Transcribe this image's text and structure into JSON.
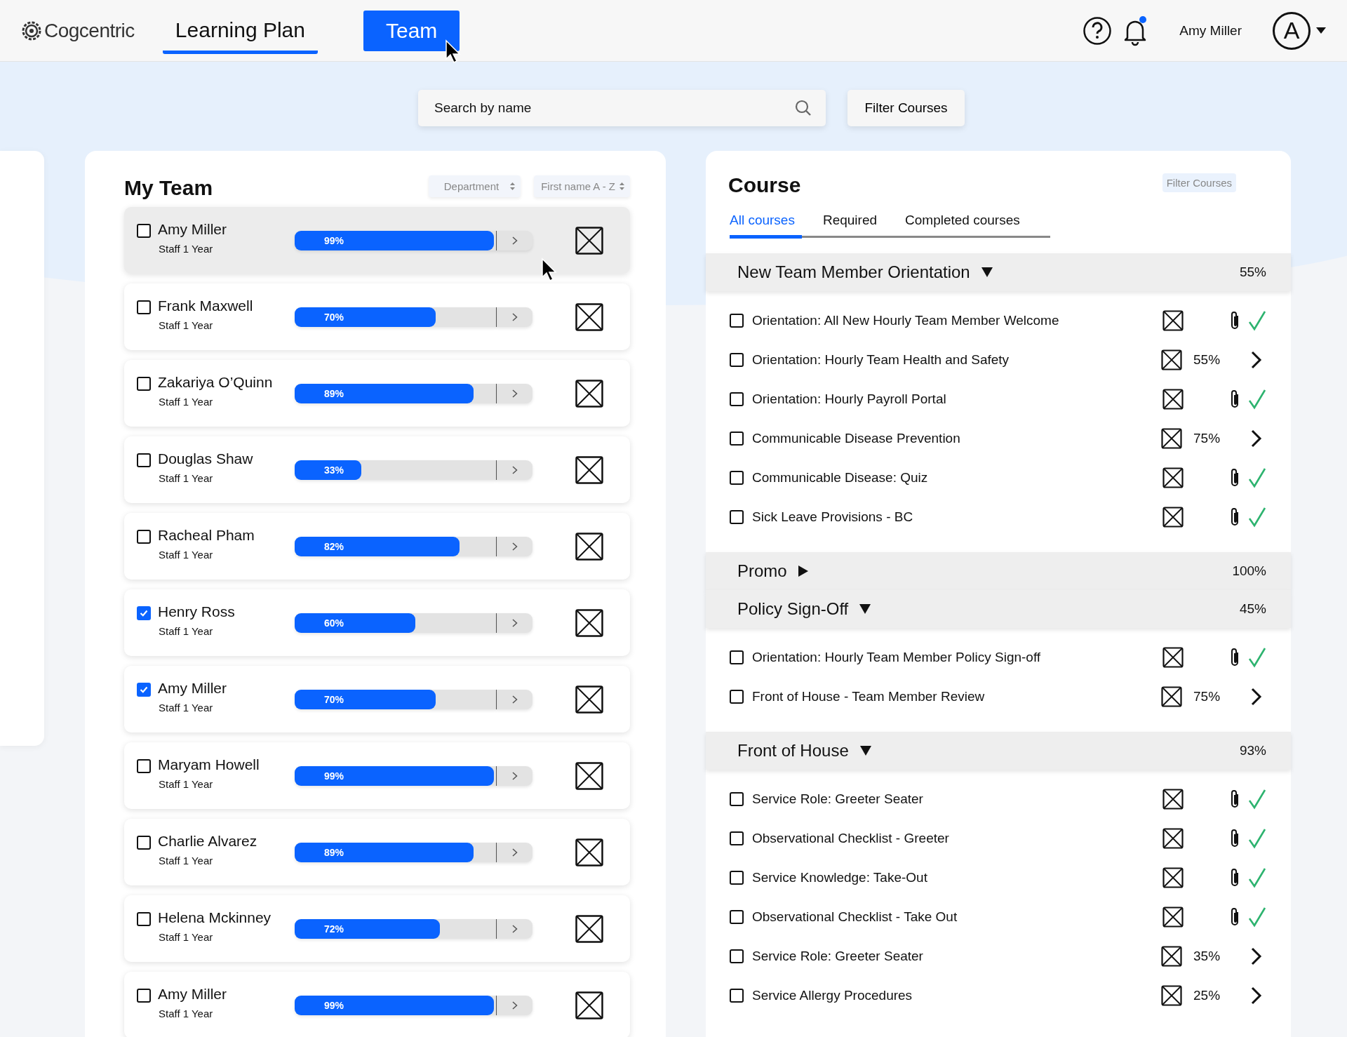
{
  "header": {
    "logo": "Cogcentric",
    "nav": [
      {
        "label": "Learning Plan",
        "selected": true,
        "kind": "tab"
      },
      {
        "label": "Team",
        "selected": false,
        "kind": "button"
      }
    ],
    "notifications": {
      "unread": true
    },
    "user": {
      "name": "Amy Miller",
      "avatar": "A"
    }
  },
  "search": {
    "placeholder": "Search by name"
  },
  "filter_button": "Filter Courses",
  "team": {
    "title": "My Team",
    "sorts": [
      "Department",
      "First name A - Z"
    ],
    "members": [
      {
        "name": "Amy Miller",
        "role": "Staff 1 Year",
        "level": 0.99,
        "reading": "99%",
        "checked": false,
        "highlighted": true
      },
      {
        "name": "Frank Maxwell",
        "role": "Staff 1 Year",
        "level": 0.7,
        "reading": "70%",
        "checked": false,
        "highlighted": false
      },
      {
        "name": "Zakariya O’Quinn",
        "role": "Staff 1 Year",
        "level": 0.89,
        "reading": "89%",
        "checked": false,
        "highlighted": false
      },
      {
        "name": "Douglas Shaw",
        "role": "Staff 1 Year",
        "level": 0.33,
        "reading": "33%",
        "checked": false,
        "highlighted": false
      },
      {
        "name": "Racheal Pham",
        "role": "Staff 1 Year",
        "level": 0.82,
        "reading": "82%",
        "checked": false,
        "highlighted": false
      },
      {
        "name": "Henry Ross",
        "role": "Staff 1 Year",
        "level": 0.6,
        "reading": "60%",
        "checked": true,
        "highlighted": false
      },
      {
        "name": "Amy Miller",
        "role": "Staff 1 Year",
        "level": 0.7,
        "reading": "70%",
        "checked": true,
        "highlighted": false
      },
      {
        "name": "Maryam Howell",
        "role": "Staff 1 Year",
        "level": 0.99,
        "reading": "99%",
        "checked": false,
        "highlighted": false
      },
      {
        "name": "Charlie Alvarez",
        "role": "Staff 1 Year",
        "level": 0.89,
        "reading": "89%",
        "checked": false,
        "highlighted": false
      },
      {
        "name": "Helena Mckinney",
        "role": "Staff 1 Year",
        "level": 0.72,
        "reading": "72%",
        "checked": false,
        "highlighted": false
      },
      {
        "name": "Amy Miller",
        "role": "Staff 1 Year",
        "level": 0.99,
        "reading": "99%",
        "checked": false,
        "highlighted": false
      }
    ]
  },
  "course": {
    "title": "Course",
    "filter": "Filter Courses",
    "tabs": [
      {
        "label": "All courses",
        "selected": true
      },
      {
        "label": "Required",
        "selected": false
      },
      {
        "label": "Completed courses",
        "selected": false
      }
    ],
    "groups": [
      {
        "name": "New Team Member Orientation",
        "expanded": true,
        "percent": "55%",
        "items": [
          {
            "title": "Orientation: All New Hourly Team Member Welcome",
            "checked": false,
            "kind": "complete"
          },
          {
            "title": "Orientation: Hourly Team Health and Safety",
            "checked": false,
            "kind": "progress",
            "percent": "55%"
          },
          {
            "title": "Orientation: Hourly Payroll Portal",
            "checked": false,
            "kind": "complete"
          },
          {
            "title": "Communicable Disease Prevention",
            "checked": false,
            "kind": "progress",
            "percent": "75%"
          },
          {
            "title": "Communicable Disease: Quiz",
            "checked": false,
            "kind": "complete"
          },
          {
            "title": "Sick Leave Provisions - BC",
            "checked": false,
            "kind": "complete"
          }
        ]
      },
      {
        "name": "Promo",
        "expanded": false,
        "percent": "100%"
      },
      {
        "name": "Policy Sign-Off",
        "expanded": true,
        "percent": "45%",
        "items": [
          {
            "title": "Orientation: Hourly Team Member Policy Sign-off",
            "checked": false,
            "kind": "complete"
          },
          {
            "title": "Front of House - Team Member Review",
            "checked": false,
            "kind": "progress",
            "percent": "75%"
          }
        ]
      },
      {
        "name": "Front of House",
        "expanded": true,
        "percent": "93%",
        "items": [
          {
            "title": "Service Role: Greeter Seater",
            "checked": false,
            "kind": "complete"
          },
          {
            "title": "Observational Checklist - Greeter",
            "checked": false,
            "kind": "complete"
          },
          {
            "title": "Service Knowledge: Take-Out",
            "checked": false,
            "kind": "complete"
          },
          {
            "title": "Observational Checklist - Take Out",
            "checked": false,
            "kind": "complete"
          },
          {
            "title": "Service Role: Greeter Seater",
            "checked": false,
            "kind": "progress",
            "percent": "35%"
          },
          {
            "title": "Service Allergy Procedures",
            "checked": false,
            "kind": "progress",
            "percent": "25%"
          }
        ]
      }
    ]
  }
}
